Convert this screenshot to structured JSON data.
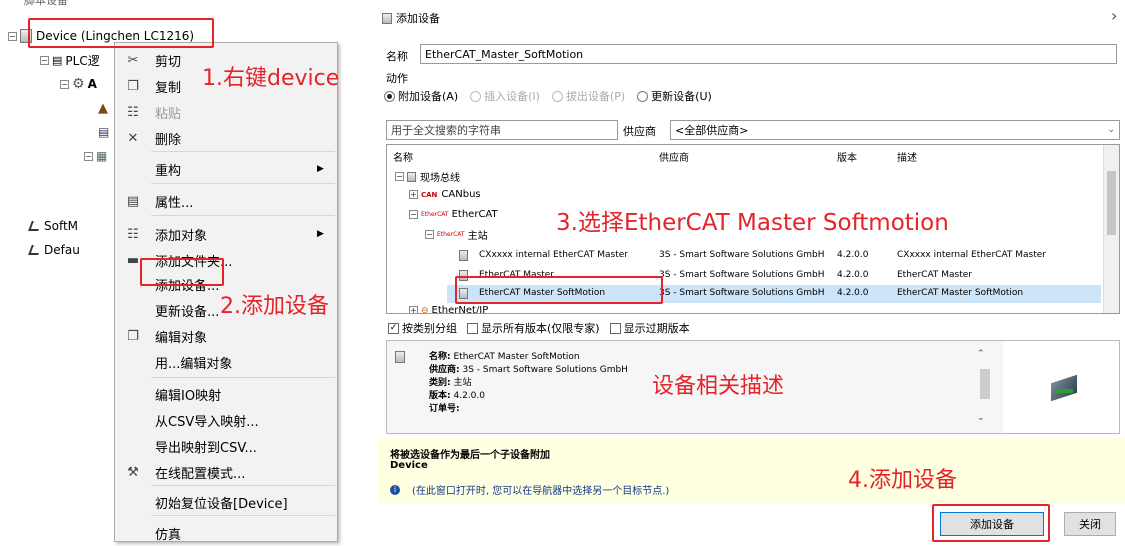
{
  "tree": {
    "partial_top": "脚本设备",
    "device": "Device (Lingchen LC1216)",
    "plc_logic": "PLC逻",
    "app_prefix": "A",
    "softmotion": "SoftM",
    "default": "Defau"
  },
  "context_menu": {
    "items": [
      {
        "icon": "scissors-icon",
        "glyph": "✂",
        "label": "剪切",
        "disabled": false
      },
      {
        "icon": "copy-icon",
        "glyph": "❐",
        "label": "复制",
        "disabled": false
      },
      {
        "icon": "paste-icon",
        "glyph": "☷",
        "label": "粘贴",
        "disabled": true
      },
      {
        "icon": "delete-icon",
        "glyph": "✕",
        "label": "删除",
        "disabled": false
      },
      {
        "icon": "",
        "glyph": "",
        "label": "重构",
        "disabled": false,
        "submenu": true
      },
      {
        "icon": "properties-icon",
        "glyph": "▤",
        "label": "属性...",
        "disabled": false
      },
      {
        "icon": "add-object-icon",
        "glyph": "☷",
        "label": "添加对象",
        "disabled": false,
        "submenu": true
      },
      {
        "icon": "folder-icon",
        "glyph": "▬",
        "label": "添加文件夹...",
        "disabled": false
      },
      {
        "icon": "",
        "glyph": "",
        "label": "添加设备...",
        "disabled": false
      },
      {
        "icon": "",
        "glyph": "",
        "label": "更新设备...",
        "disabled": false
      },
      {
        "icon": "edit-object-icon",
        "glyph": "❐",
        "label": "编辑对象",
        "disabled": false
      },
      {
        "icon": "",
        "glyph": "",
        "label": "用...编辑对象",
        "disabled": false
      },
      {
        "icon": "",
        "glyph": "",
        "label": "编辑IO映射",
        "disabled": false
      },
      {
        "icon": "",
        "glyph": "",
        "label": "从CSV导入映射...",
        "disabled": false
      },
      {
        "icon": "",
        "glyph": "",
        "label": "导出映射到CSV...",
        "disabled": false
      },
      {
        "icon": "online-config-icon",
        "glyph": "⚒",
        "label": "在线配置模式...",
        "disabled": false
      },
      {
        "icon": "",
        "glyph": "",
        "label": "初始复位设备[Device]",
        "disabled": false
      },
      {
        "icon": "",
        "glyph": "",
        "label": "仿真",
        "disabled": false
      }
    ]
  },
  "dialog": {
    "title": "添加设备",
    "close_glyph": "›",
    "name_label": "名称",
    "name_value": "EtherCAT_Master_SoftMotion",
    "action_label": "动作",
    "radios": [
      {
        "label": "附加设备(A)",
        "checked": true,
        "disabled": false
      },
      {
        "label": "插入设备(I)",
        "checked": false,
        "disabled": true
      },
      {
        "label": "拔出设备(P)",
        "checked": false,
        "disabled": true
      },
      {
        "label": "更新设备(U)",
        "checked": false,
        "disabled": false
      }
    ],
    "search_placeholder": "用于全文搜索的字符串",
    "vendor_label": "供应商",
    "vendor_value": "<全部供应商>",
    "columns": [
      "名称",
      "供应商",
      "版本",
      "描述"
    ],
    "tree": {
      "fieldbus": "现场总线",
      "canbus_badge": "CAN",
      "canbus": "CANbus",
      "ethercat_badge": "EtherCAT",
      "ethercat": "EtherCAT",
      "master": "主站",
      "ethernetip": "EtherNet/IP"
    },
    "rows": [
      {
        "name": "CXxxxx internal EtherCAT Master",
        "vendor": "3S - Smart Software Solutions GmbH",
        "version": "4.2.0.0",
        "desc": "CXxxxx internal EtherCAT Master"
      },
      {
        "name": "EtherCAT Master",
        "vendor": "3S - Smart Software Solutions GmbH",
        "version": "4.2.0.0",
        "desc": "EtherCAT Master"
      },
      {
        "name": "EtherCAT Master SoftMotion",
        "vendor": "3S - Smart Software Solutions GmbH",
        "version": "4.2.0.0",
        "desc": "EtherCAT Master SoftMotion"
      }
    ],
    "checkboxes": [
      {
        "label": "按类别分组",
        "checked": true
      },
      {
        "label": "显示所有版本(仅限专家)",
        "checked": false
      },
      {
        "label": "显示过期版本",
        "checked": false
      }
    ],
    "info": {
      "name_key": "名称:",
      "name_val": "EtherCAT Master SoftMotion",
      "vendor_key": "供应商:",
      "vendor_val": "3S - Smart Software Solutions GmbH",
      "category_key": "类别:",
      "category_val": "主站",
      "version_key": "版本:",
      "version_val": "4.2.0.0",
      "order_key": "订单号:"
    },
    "footer_title": "将被选设备作为最后一个子设备附加",
    "footer_device": "Device",
    "footer_hint": "(在此窗口打开时, 您可以在导航器中选择另一个目标节点.)",
    "add_button": "添加设备",
    "close_button": "关闭"
  },
  "annotations": {
    "step1": "1.右键device",
    "step2": "2.添加设备",
    "step3": "3.选择EtherCAT Master Softmotion",
    "desc": "设备相关描述",
    "step4": "4.添加设备"
  },
  "colors": {
    "annotation_red": "#e4232a",
    "selection_blue": "#cce4f7",
    "footer_yellow": "#ffffe1"
  }
}
